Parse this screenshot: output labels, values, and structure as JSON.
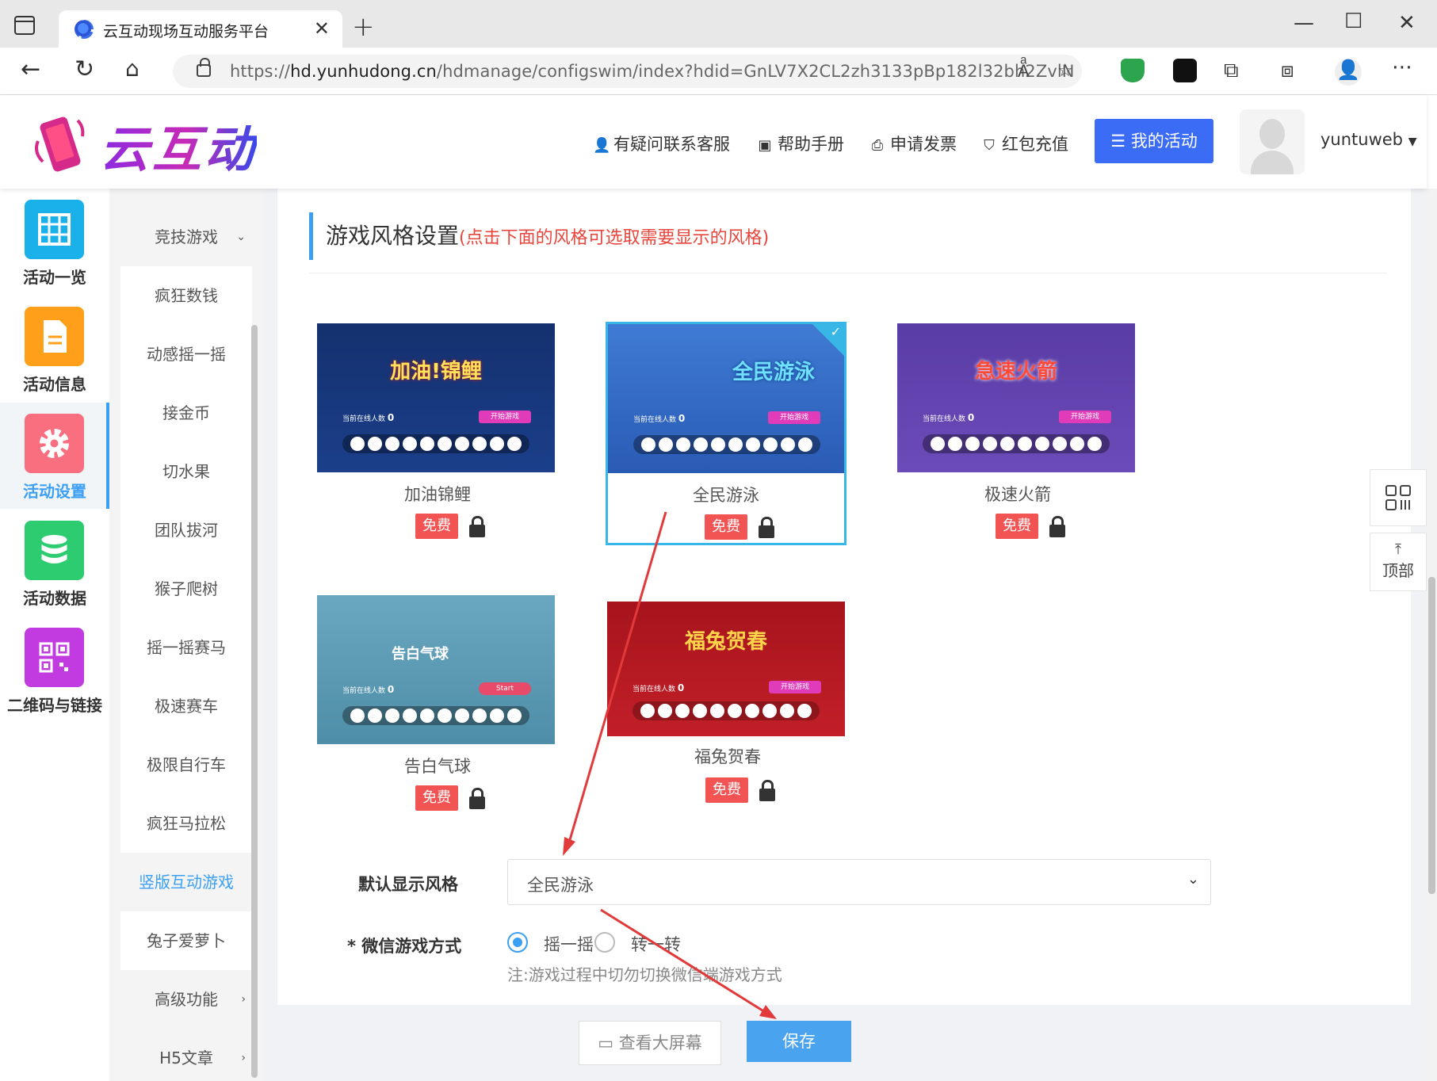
{
  "browser": {
    "tab_title": "云互动现场互动服务平台",
    "url_prefix": "https://",
    "url_host": "hd.yunhudong.cn",
    "url_path": "/hdmanage/configswim/index?hdid=GnLV7X2CL2zh3133pBp182l32bh2ZvlN"
  },
  "header": {
    "logo_text": "云互动",
    "links": [
      "有疑问联系客服",
      "帮助手册",
      "申请发票",
      "红包充值"
    ],
    "my_activity": "我的活动",
    "username": "yuntuweb"
  },
  "leftnav": {
    "items": [
      {
        "label": "活动一览",
        "color": "#1ab0ea"
      },
      {
        "label": "活动信息",
        "color": "#ff9f1a"
      },
      {
        "label": "活动设置",
        "color": "#f96f7f"
      },
      {
        "label": "活动数据",
        "color": "#2ecc71"
      },
      {
        "label": "二维码与链接",
        "color": "#c23be0"
      }
    ]
  },
  "submenu": {
    "items": [
      "竞技游戏",
      "疯狂数钱",
      "动感摇一摇",
      "接金币",
      "切水果",
      "团队拔河",
      "猴子爬树",
      "摇一摇赛马",
      "极速赛车",
      "极限自行车",
      "疯狂马拉松",
      "竖版互动游戏",
      "兔子爱萝卜",
      "高级功能",
      "H5文章"
    ]
  },
  "section": {
    "title": "游戏风格设置",
    "hint": "(点击下面的风格可选取需要显示的风格)"
  },
  "styles": [
    {
      "thumb_title": "加油!锦鲤",
      "name": "加油锦鲤",
      "badge": "免费",
      "online": "当前在线人数",
      "count": "0",
      "btn": "开始游戏"
    },
    {
      "thumb_title": "全民游泳",
      "name": "全民游泳",
      "badge": "免费",
      "online": "当前在线人数",
      "count": "0",
      "btn": "开始游戏"
    },
    {
      "thumb_title": "急速火箭",
      "name": "极速火箭",
      "badge": "免费",
      "online": "当前在线人数",
      "count": "0",
      "btn": "开始游戏"
    },
    {
      "thumb_title": "告白气球",
      "name": "告白气球",
      "badge": "免费",
      "online": "当前在线人数",
      "count": "0",
      "btn": "Start"
    },
    {
      "thumb_title": "福兔贺春",
      "name": "福兔贺春",
      "badge": "免费",
      "online": "当前在线人数",
      "count": "0",
      "btn": "开始游戏"
    }
  ],
  "form": {
    "default_style_label": "默认显示风格",
    "default_style_value": "全民游泳",
    "wechat_mode_label": "* 微信游戏方式",
    "mode_options": [
      "摇一摇",
      "转一转"
    ],
    "note": "注:游戏过程中切勿切换微信端游戏方式"
  },
  "buttons": {
    "view_screen": "查看大屏幕",
    "save": "保存"
  },
  "float": {
    "top": "顶部"
  }
}
